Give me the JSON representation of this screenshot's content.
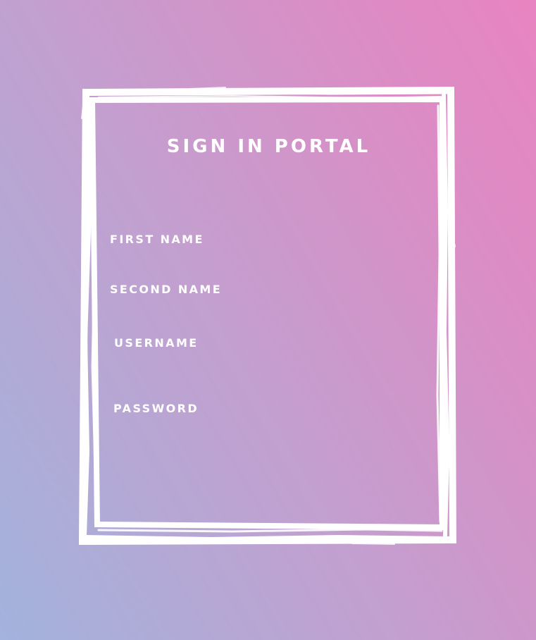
{
  "portal": {
    "title": "SIGN IN PORTAL",
    "fields": {
      "first_name": "FIRST NAME",
      "second_name": "SECOND NAME",
      "username": "USERNAME",
      "password": "PASSWORD"
    }
  },
  "colors": {
    "background_gradient_start": "#a2b3dc",
    "background_gradient_end": "#e884c1",
    "frame": "#ffffff",
    "text": "#ffffff"
  }
}
